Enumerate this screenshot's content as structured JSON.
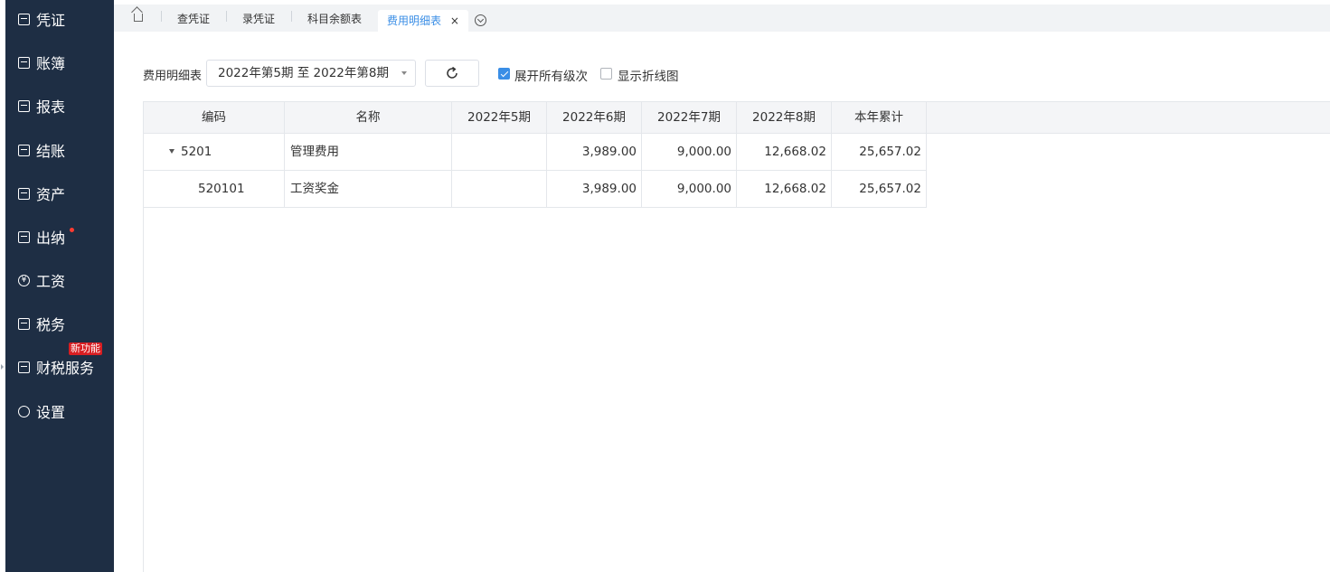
{
  "sidebar": {
    "items": [
      {
        "label": "凭证"
      },
      {
        "label": "账簿"
      },
      {
        "label": "报表"
      },
      {
        "label": "结账"
      },
      {
        "label": "资产"
      },
      {
        "label": "出纳"
      },
      {
        "label": "工资"
      },
      {
        "label": "税务"
      },
      {
        "label": "财税服务"
      },
      {
        "label": "设置"
      }
    ],
    "new_badge": "新功能",
    "accent": "#1e2e44"
  },
  "tabs": [
    {
      "label": "查凭证"
    },
    {
      "label": "录凭证"
    },
    {
      "label": "科目余额表"
    },
    {
      "label": "费用明细表",
      "active": true
    }
  ],
  "tab_close": "×",
  "toolbar": {
    "report_label": "费用明细表",
    "period_value": "2022年第5期 至 2022年第8期",
    "expand_all_label": "展开所有级次",
    "expand_all_checked": true,
    "show_line_chart_label": "显示折线图",
    "show_line_chart_checked": false
  },
  "table": {
    "headers": [
      "编码",
      "名称",
      "2022年5期",
      "2022年6期",
      "2022年7期",
      "2022年8期",
      "本年累计"
    ],
    "rows": [
      {
        "code": "5201",
        "name": "管理费用",
        "p5": "",
        "p6": "3,989.00",
        "p7": "9,000.00",
        "p8": "12,668.02",
        "ytd": "25,657.02"
      },
      {
        "code": "520101",
        "name": "工资奖金",
        "p5": "",
        "p6": "3,989.00",
        "p7": "9,000.00",
        "p8": "12,668.02",
        "ytd": "25,657.02"
      }
    ]
  },
  "colors": {
    "active_tab": "#3a8ee6",
    "checkbox": "#3a8ee6",
    "badge": "#d81e22",
    "header_bg": "#f4f5f7"
  }
}
